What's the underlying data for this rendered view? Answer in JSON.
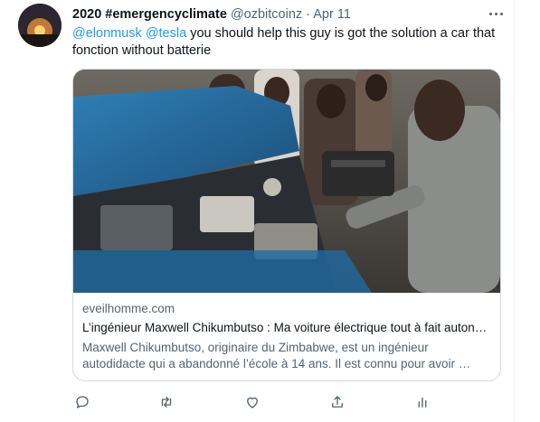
{
  "tweet": {
    "display_name": "2020 #emergencyclimate",
    "handle": "@ozbitcoinz",
    "separator": "·",
    "date": "Apr 11",
    "mentions": [
      "@elonmusk",
      "@tesla"
    ],
    "text_body": " you should help this guy is got the solution a car that fonction without batterie"
  },
  "card": {
    "domain": "eveilhomme.com",
    "title": "L’ingénieur Maxwell Chikumbutso : Ma voiture électrique tout à fait autonome",
    "description": "Maxwell Chikumbutso, originaire du Zimbabwe, est un ingénieur autodidacte qui a abandonné l’école à 14 ans. Il est connu pour avoir …"
  },
  "actions": {
    "reply_icon": "reply-icon",
    "retweet_icon": "retweet-icon",
    "like_icon": "like-icon",
    "share_icon": "share-icon",
    "analytics_icon": "analytics-icon"
  },
  "colors": {
    "link": "#1d9bf0",
    "secondary_text": "#536471",
    "border": "#cfd9de"
  }
}
